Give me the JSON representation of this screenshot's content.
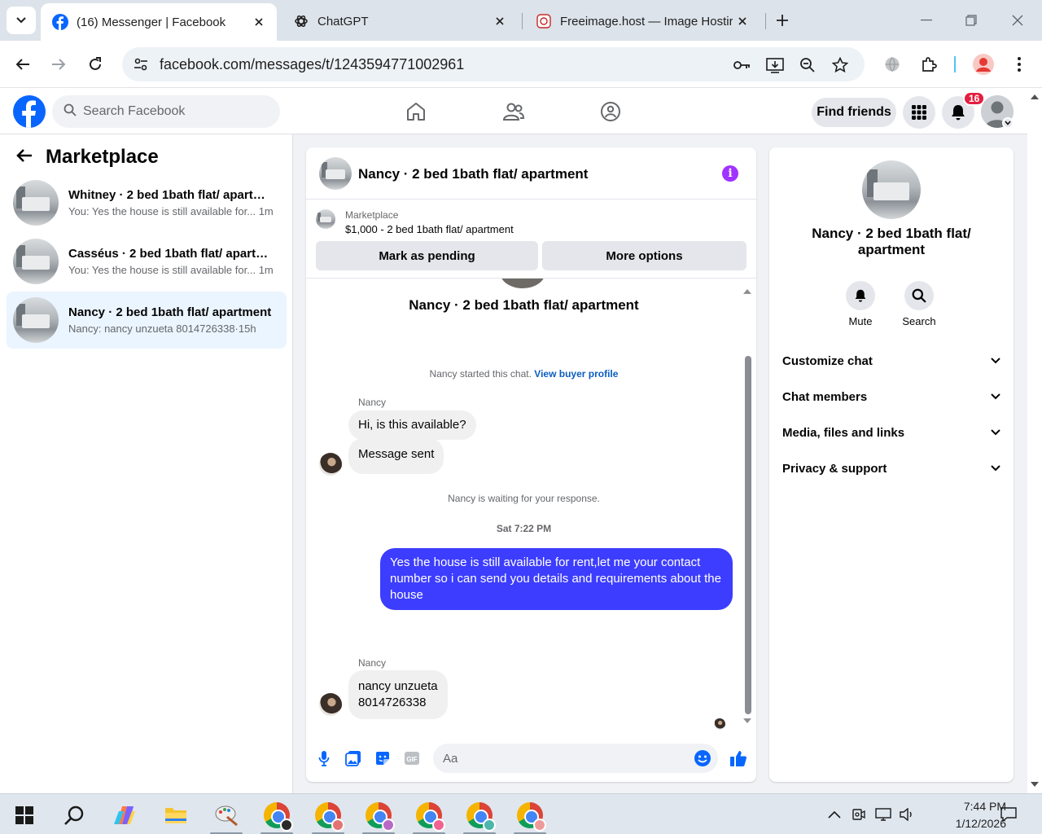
{
  "browser": {
    "tabs": [
      {
        "title": "(16) Messenger | Facebook",
        "active": true
      },
      {
        "title": "ChatGPT",
        "active": false
      },
      {
        "title": "Freeimage.host — Image Hostir",
        "active": false
      }
    ],
    "url": "facebook.com/messages/t/1243594771002961"
  },
  "facebook": {
    "search_placeholder": "Search Facebook",
    "find_friends": "Find friends",
    "notification_count": "16",
    "brand_color": "#0866ff"
  },
  "sidebar": {
    "title": "Marketplace",
    "conversations": [
      {
        "name": "Whitney · 2 bed 1bath flat/ apartm...",
        "preview": "You: Yes the house is still available for...",
        "time": "1m",
        "selected": false
      },
      {
        "name": "Casséus · 2 bed 1bath flat/ apartm...",
        "preview": "You: Yes the house is still available for...",
        "time": "1m",
        "selected": false
      },
      {
        "name": "Nancy · 2 bed 1bath flat/ apartment",
        "preview": "Nancy: nancy unzueta 8014726338",
        "time": "15h",
        "selected": true
      }
    ]
  },
  "chat": {
    "header_title": "Nancy · 2 bed 1bath flat/ apartment",
    "marketplace_label": "Marketplace",
    "listing_summary": "$1,000 - 2 bed 1bath flat/ apartment",
    "mark_pending": "Mark as pending",
    "more_options": "More options",
    "listing_title": "Nancy · 2 bed 1bath flat/ apartment",
    "started_text": "Nancy started this chat.",
    "view_profile": "View buyer profile",
    "sender_name": "Nancy",
    "msg1": "Hi, is this available?",
    "msg2": "Message sent",
    "waiting_text": "Nancy is waiting for your response.",
    "timestamp": "Sat 7:22 PM",
    "outgoing": "Yes the house is still available for rent,let me your contact number so i can send you details and requirements about the house",
    "sender_name2": "Nancy",
    "msg3_line1": "nancy unzueta",
    "msg3_line2": "8014726338",
    "composer_placeholder": "Aa",
    "outgoing_color": "#3d3dff"
  },
  "details": {
    "name": "Nancy · 2 bed 1bath flat/ apartment",
    "mute": "Mute",
    "search": "Search",
    "sections": [
      "Customize chat",
      "Chat members",
      "Media, files and links",
      "Privacy & support"
    ]
  },
  "taskbar": {
    "time": "7:44 PM",
    "date": "1/12/2026"
  }
}
